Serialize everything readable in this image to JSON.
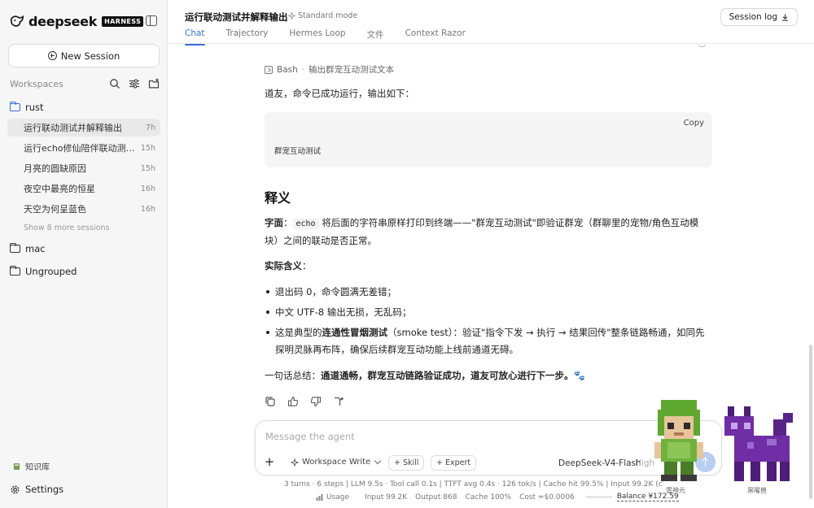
{
  "brand": {
    "name": "deepseek",
    "badge": "HARNESS"
  },
  "sidebar": {
    "new_session": "New Session",
    "workspaces_label": "Workspaces",
    "folders": [
      {
        "name": "rust",
        "sessions": [
          {
            "title": "运行联动测试并解释输出",
            "time": "7h",
            "active": true
          },
          {
            "title": "运行echo修仙陪伴联动测试...",
            "time": "15h"
          },
          {
            "title": "月亮的圆缺原因",
            "time": "15h"
          },
          {
            "title": "夜空中最亮的恒星",
            "time": "16h"
          },
          {
            "title": "天空为何呈蓝色",
            "time": "16h"
          }
        ],
        "show_more": "Show 8 more sessions"
      },
      {
        "name": "mac"
      },
      {
        "name": "Ungrouped"
      }
    ],
    "knowledge_base": "知识库",
    "settings": "Settings"
  },
  "header": {
    "title": "运行联动测试并解释输出",
    "mode": "Standard mode",
    "tabs": [
      "Chat",
      "Trajectory",
      "Hermes Loop",
      "文件",
      "Context Razor"
    ],
    "session_log": "Session log"
  },
  "message": {
    "tool_name": "Bash",
    "tool_desc": "输出群宠互动测试文本",
    "intro": "道友，命令已成功运行，输出如下：",
    "copy": "Copy",
    "code_output": "群宠互动测试",
    "heading": "释义",
    "p1_label": "字面",
    "p1_colon": "：",
    "p1_code": "echo",
    "p1_text": " 将后面的字符串原样打印到终端——\"群宠互动测试\"即验证群宠（群聊里的宠物/角色互动模",
    "p1_text2": "块）之间的联动是否正常。",
    "p2_label": "实际含义",
    "p2_colon": "：",
    "bullet1": "退出码 0，命令圆满无差错；",
    "bullet2": "中文 UTF-8 输出无损，无乱码；",
    "bullet3_pre": "这是典型的",
    "bullet3_bold": "连通性冒烟测试",
    "bullet3_post": "（smoke test）：验证\"指令下发 → 执行 → 结果回传\"整条链路畅通，如同先",
    "bullet3_post2": "探明灵脉再布阵，确保后续群宠互动功能上线前通道无碍。",
    "summary_pre": "一句话总结：",
    "summary_bold": "通道通畅，群宠互动链路验证成功，道友可放心进行下一步。",
    "summary_emoji": "🐾"
  },
  "composer": {
    "placeholder": "Message the agent",
    "workspace": "Workspace Write",
    "skill": "+ Skill",
    "expert": "+ Expert",
    "model": "DeepSeek-V4-Flash",
    "level": "High"
  },
  "stats": {
    "line1": "3 turns · 6 steps   |   LLM 9.5s · Tool call 0.1s   |   TTFT avg 0.4s · 126 tok/s   |   Cache hit 99.5%   |   Input 99.2K (c",
    "usage": "Usage",
    "input": "Input 99.2K",
    "output": "Output 868",
    "cache": "Cache 100%",
    "cost": "Cost ≈$0.0006",
    "balance": "Balance ¥172.59"
  },
  "pets": [
    {
      "name": "雷神元",
      "color": "#6fb33d"
    },
    {
      "name": "黑曜兽",
      "color": "#6f2ea5"
    }
  ],
  "colors": {
    "accent": "#3a6fd8",
    "send": "#b8cdf3"
  }
}
